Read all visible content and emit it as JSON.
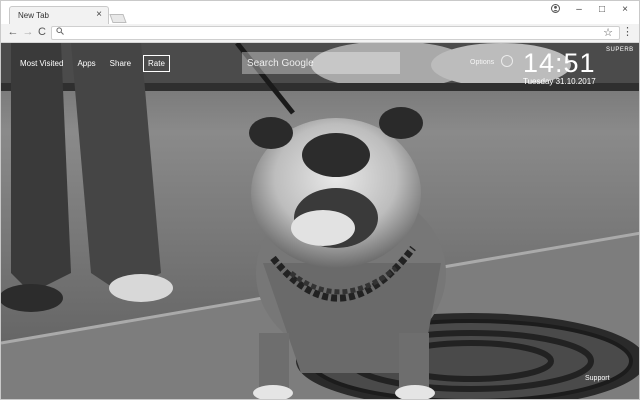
{
  "browser": {
    "tab_title": "New Tab",
    "tab_close": "×",
    "window_controls": [
      "–",
      "□",
      "×"
    ],
    "profile_icon": "profile-icon",
    "address_value": "",
    "back_icon": "←",
    "forward_icon": "→",
    "reload_icon": "C",
    "search_glyph": "🔍",
    "star_glyph": "☆",
    "menu_glyph": "⋮"
  },
  "newtab": {
    "nav": {
      "most_visited": "Most Visited",
      "apps": "Apps",
      "share": "Share",
      "rate": "Rate"
    },
    "search_placeholder": "Search Google",
    "options_label": "Options",
    "clock_time": "14:51",
    "clock_date": "Tuesday 31.10.2017",
    "brand": "SUPERB",
    "support": "Support"
  },
  "colors": {
    "chrome_bg": "#f2f2f2",
    "tab_bg": "#f2f2f2",
    "overlay_text": "#ffffff"
  }
}
